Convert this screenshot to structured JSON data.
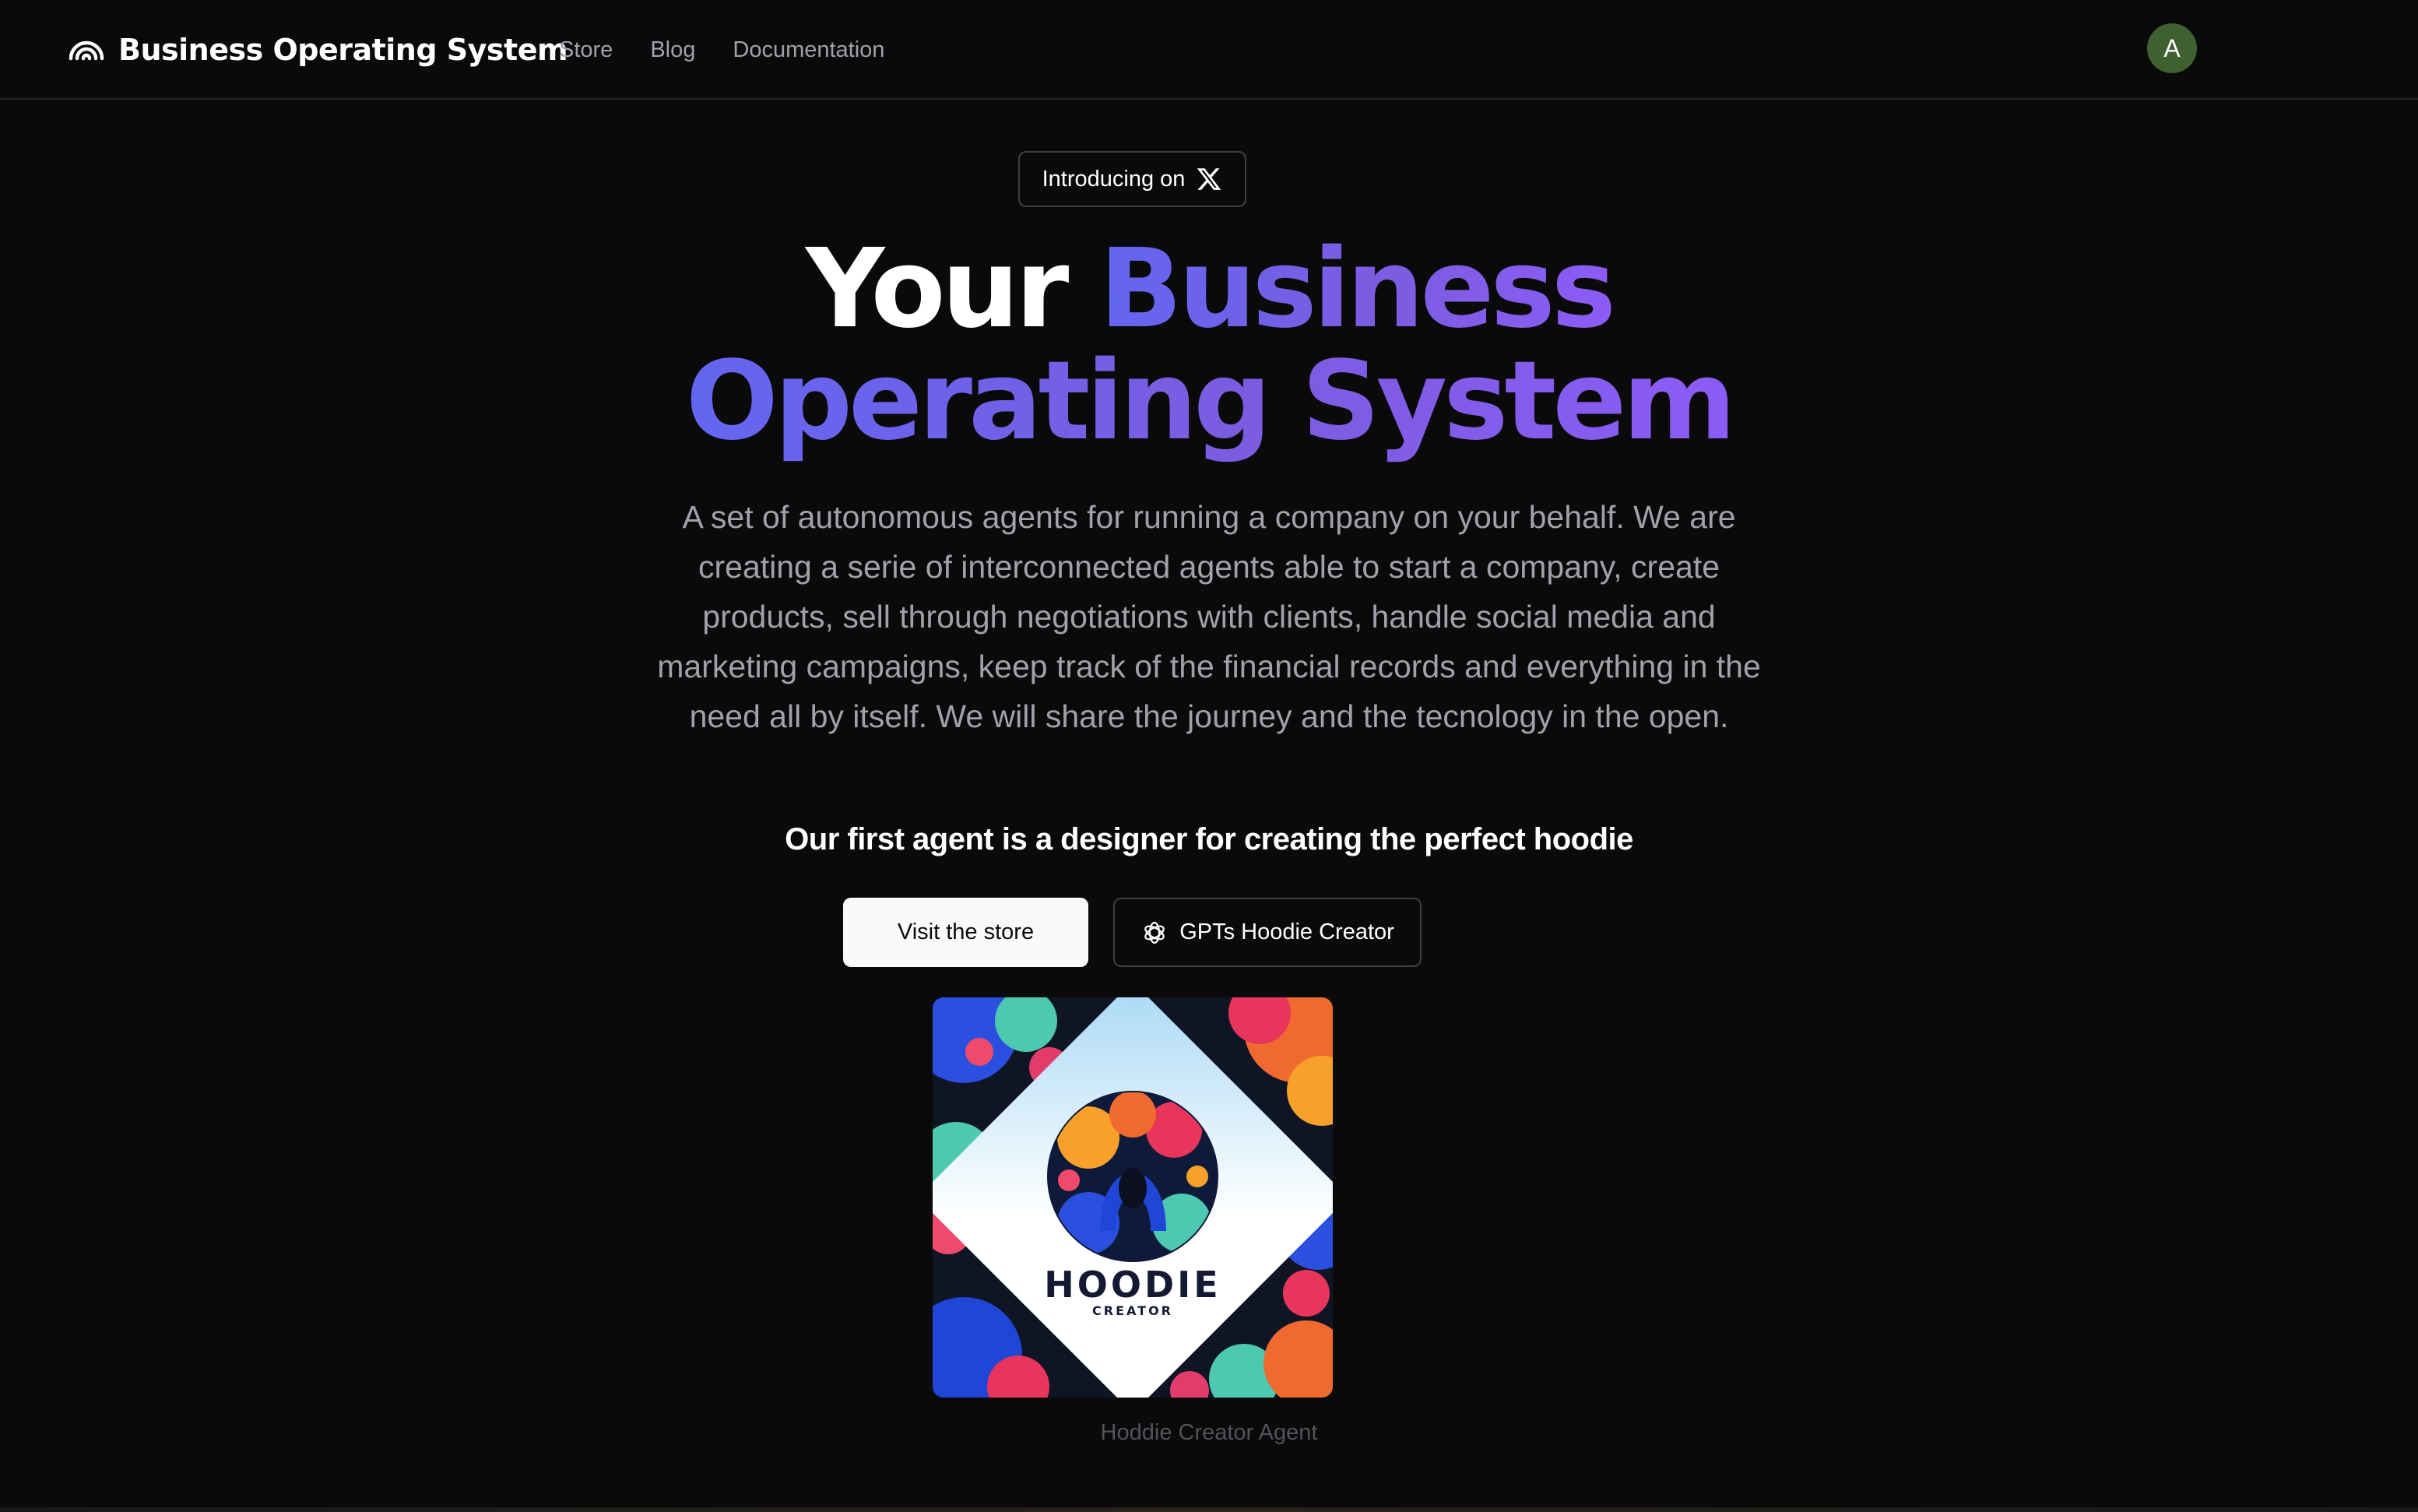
{
  "header": {
    "brand_icon": "rainbow-arcs-icon",
    "brand_name": "Business Operating System",
    "nav": [
      {
        "label": "Store"
      },
      {
        "label": "Blog"
      },
      {
        "label": "Documentation"
      }
    ],
    "avatar_initial": "A",
    "avatar_color": "#3f6130"
  },
  "hero": {
    "announcement": {
      "label": "Introducing on",
      "icon": "x-logo-icon"
    },
    "headline": {
      "white_part": "Your",
      "gradient_line1": "Business",
      "gradient_line2": "Operating System",
      "gradient_colors": [
        "#6366f1",
        "#8b5cf6"
      ]
    },
    "description": "A set of autonomous agents for running a company on your behalf. We are creating a serie of interconnected agents able to start a company, create products, sell through negotiations with clients, handle social media and marketing campaigns, keep track of the financial records and everything in the need all by itself. We will share the journey and the tecnology in the open.",
    "subheading": "Our first agent is a designer for creating the perfect hoodie",
    "buttons": {
      "primary_label": "Visit the store",
      "secondary_label": "GPTs Hoodie Creator",
      "secondary_icon": "openai-logo-icon"
    },
    "image": {
      "logo_title": "HOODIE",
      "logo_subtitle": "CREATOR",
      "caption": "Hoddie Creator Agent"
    }
  }
}
